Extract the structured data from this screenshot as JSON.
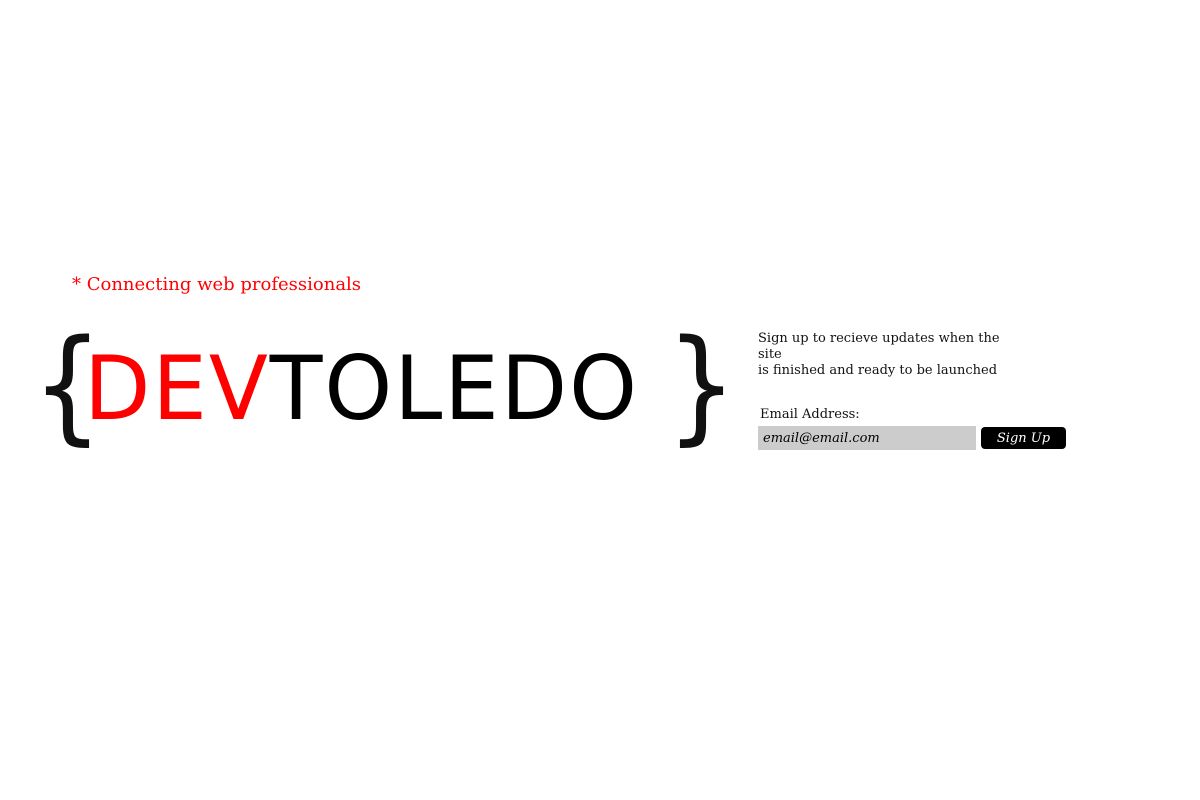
{
  "header": {
    "tagline": "* Connecting web professionals"
  },
  "logo": {
    "brace_left": "{",
    "part_dev": "DEV",
    "part_toledo": "TOLEDO",
    "brace_right": "}"
  },
  "signup": {
    "description_line1": "Sign up to recieve updates when the site",
    "description_line2": "is finished and ready to be launched",
    "email_label": "Email Address:",
    "email_placeholder": "email@email.com",
    "button_label": "Sign Up"
  },
  "colors": {
    "accent": "#ff0000",
    "text": "#000000",
    "input_background": "#cccccc",
    "button_background": "#000000",
    "button_text": "#ffffff"
  }
}
